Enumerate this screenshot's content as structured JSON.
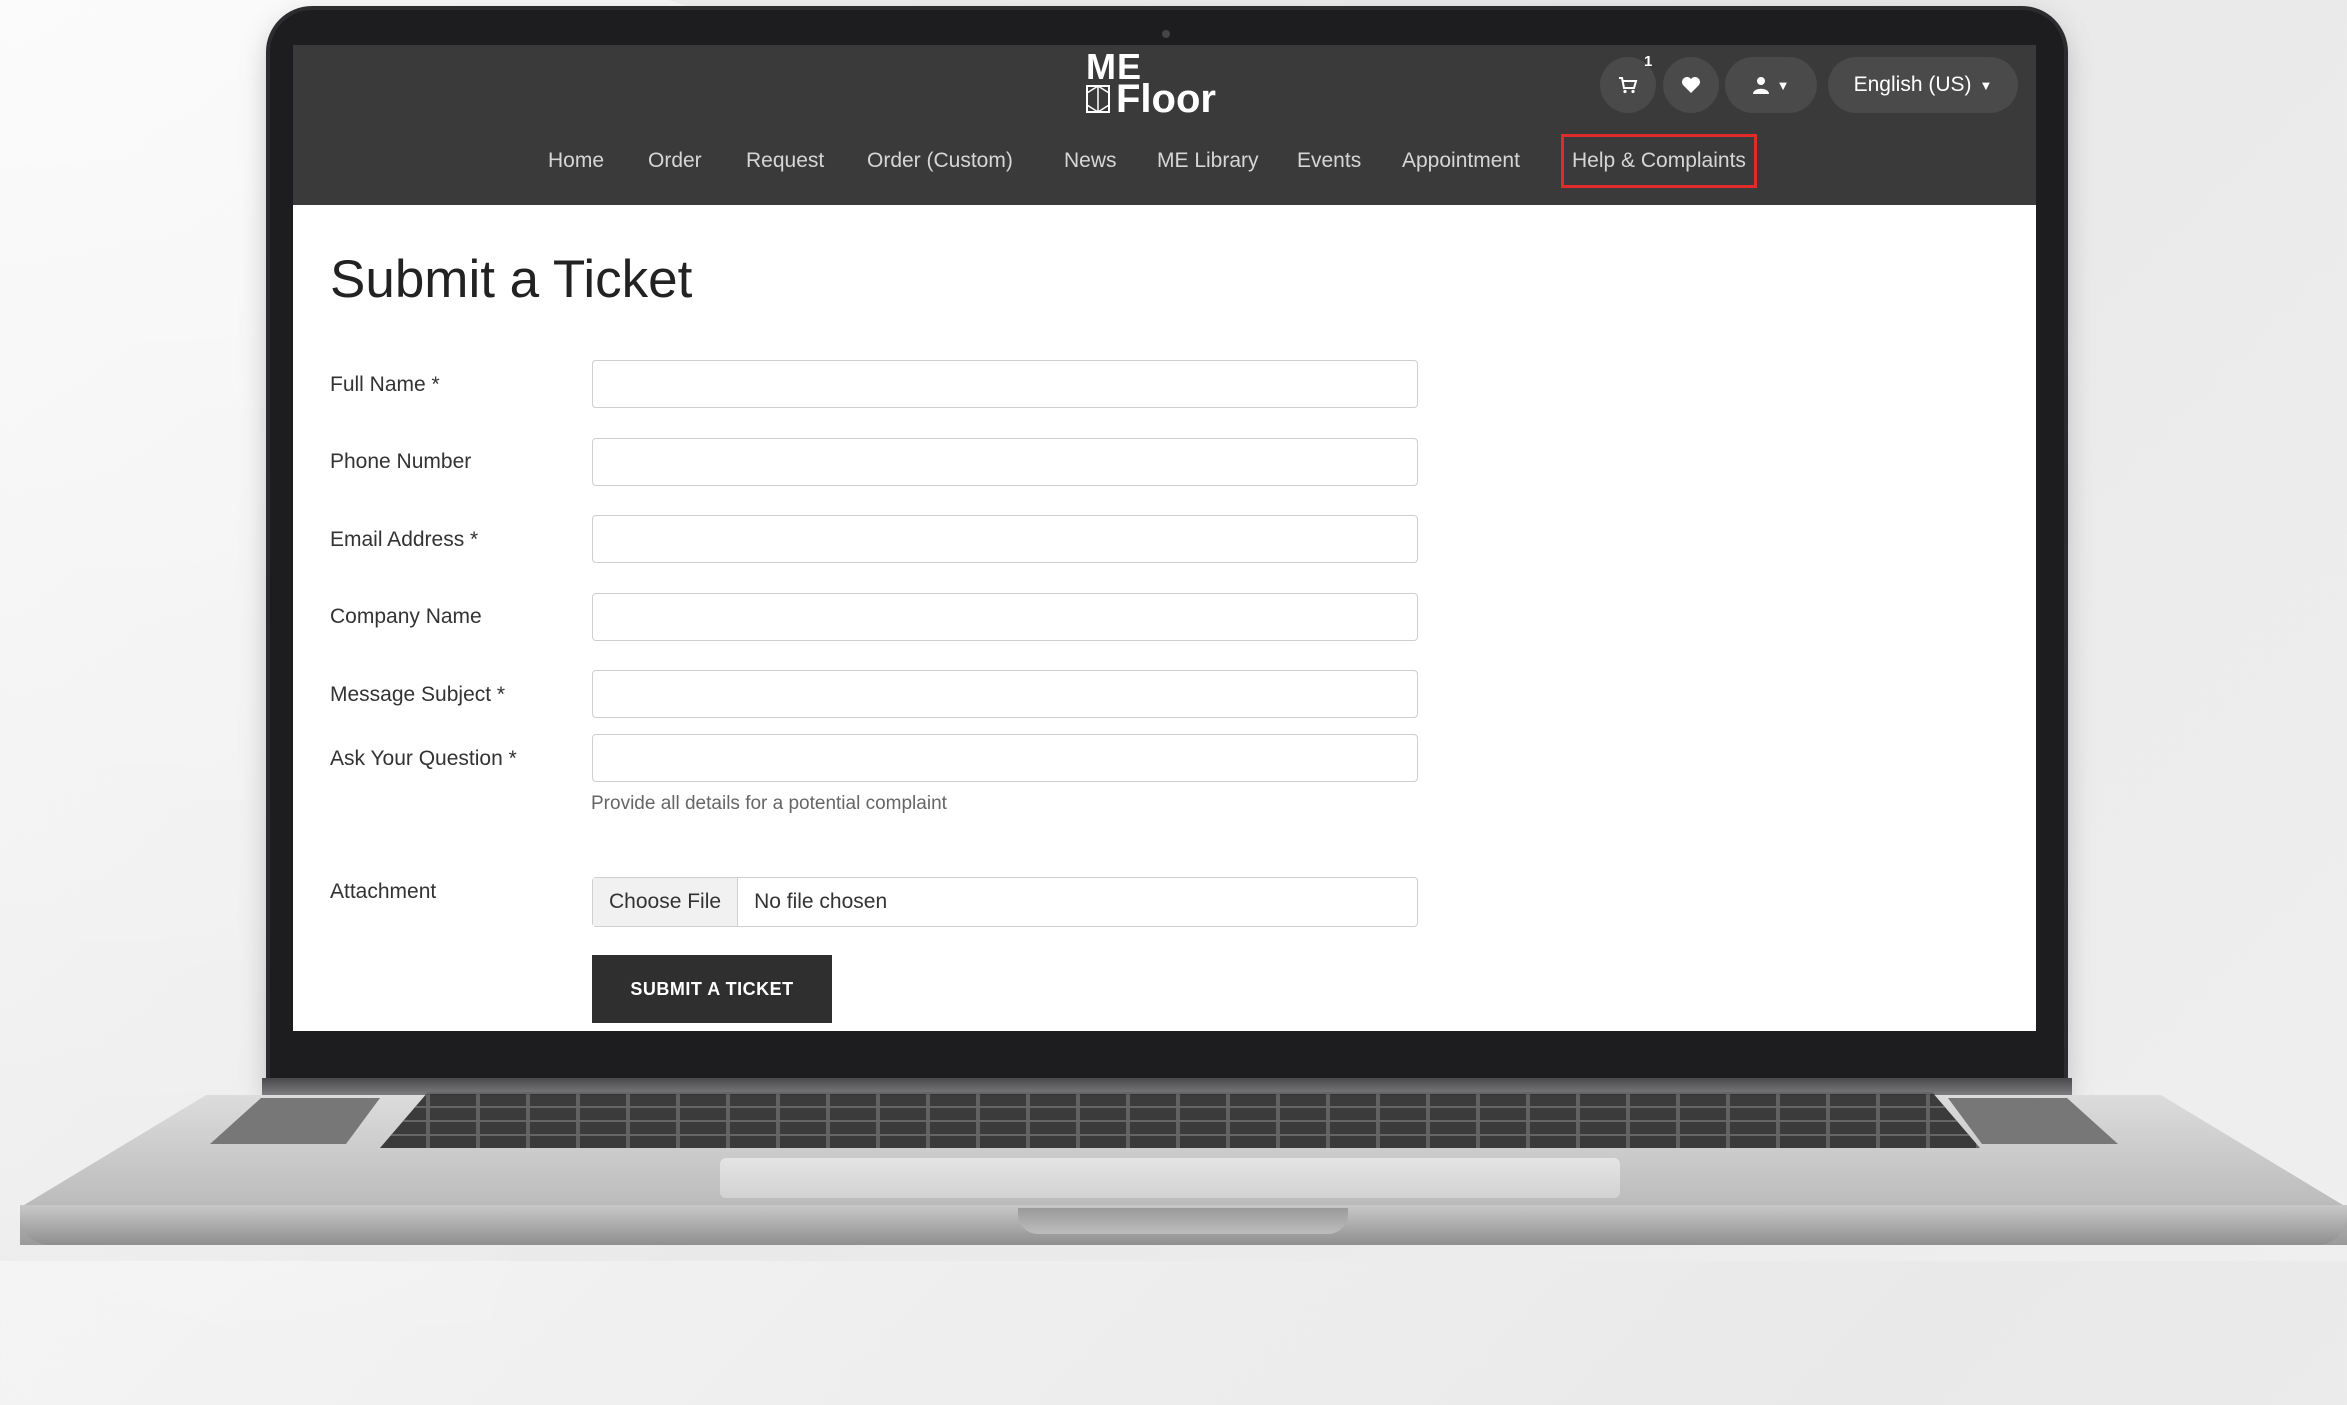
{
  "brand": {
    "line1": "ME",
    "line2": "Floor"
  },
  "header": {
    "cart_count": "1",
    "language": "English (US)"
  },
  "nav": {
    "items": [
      {
        "label": "Home"
      },
      {
        "label": "Order"
      },
      {
        "label": "Request"
      },
      {
        "label": "Order (Custom)"
      },
      {
        "label": "News"
      },
      {
        "label": "ME Library"
      },
      {
        "label": "Events"
      },
      {
        "label": "Appointment"
      },
      {
        "label": "Help & Complaints",
        "active": true
      }
    ]
  },
  "form": {
    "title": "Submit a Ticket",
    "fields": {
      "full_name": {
        "label": "Full Name *",
        "value": ""
      },
      "phone": {
        "label": "Phone Number",
        "value": ""
      },
      "email": {
        "label": "Email Address *",
        "value": ""
      },
      "company": {
        "label": "Company Name",
        "value": ""
      },
      "subject": {
        "label": "Message Subject *",
        "value": ""
      },
      "question": {
        "label": "Ask Your Question *",
        "value": "",
        "help": "Provide all details for a potential complaint"
      }
    },
    "attachment": {
      "label": "Attachment",
      "button": "Choose File",
      "status": "No file chosen"
    },
    "submit_label": "SUBMIT A TICKET"
  },
  "colors": {
    "header_bg": "#3a3a3a",
    "active_outline": "#e02b2b",
    "submit_bg": "#2f2f2f"
  }
}
